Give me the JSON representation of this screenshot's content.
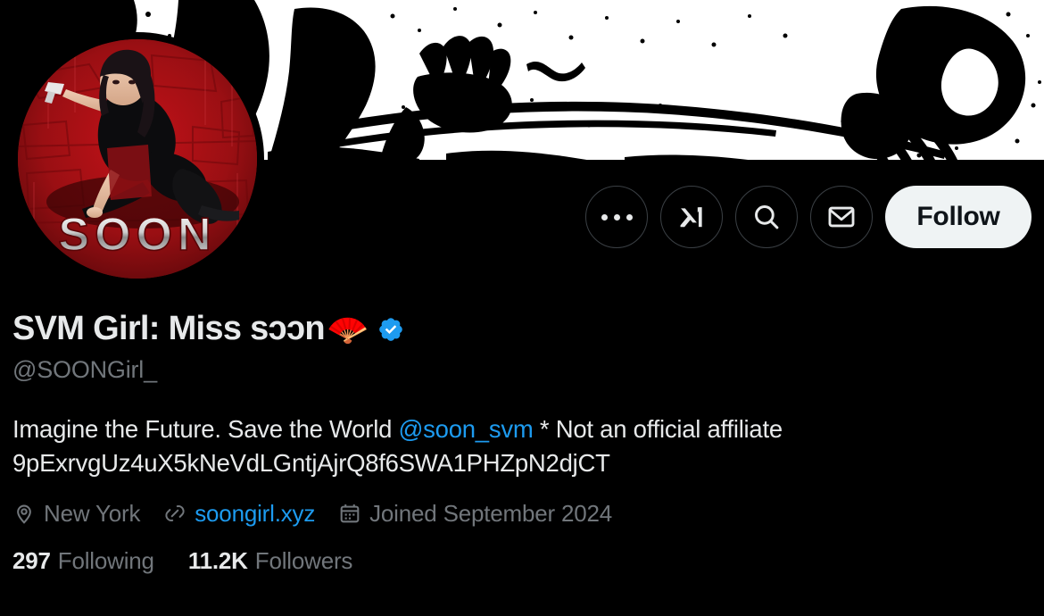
{
  "banner": {
    "alt": "high-contrast black and white dithered manga artwork banner",
    "background_color": "#ffffff",
    "ink_color": "#000000"
  },
  "avatar": {
    "alt": "red toned photo collage of a woman in black outfit holding a gun with SOON logotype",
    "base_color": "#8b0f10",
    "label": "SOON"
  },
  "actions": {
    "more_label": "More",
    "more_icon": "ellipsis-icon",
    "grok_label": "Grok",
    "grok_icon": "xai-grok-icon",
    "search_label": "Search",
    "search_icon": "search-icon",
    "message_label": "Message",
    "message_icon": "envelope-icon",
    "follow_label": "Follow"
  },
  "profile": {
    "display_name": "SVM Girl: Miss sɔɔn",
    "name_emoji": "🪭",
    "verified": true,
    "verified_icon": "verified-badge-icon",
    "verified_color": "#1d9bf0",
    "handle": "@SOONGirl_",
    "bio_line_1_before": "Imagine the Future. Save the World ",
    "bio_mention": "@soon_svm",
    "bio_line_1_after": " * Not an official affiliate",
    "bio_line_2": "9pExrvgUz4uX5kNeVdLGntjAjrQ8f6SWA1PHZpN2djCT",
    "location": "New York",
    "location_icon": "location-pin-icon",
    "website": "soongirl.xyz",
    "website_icon": "link-icon",
    "joined": "Joined September 2024",
    "joined_icon": "calendar-icon",
    "following_count": "297",
    "following_label": "Following",
    "followers_count": "11.2K",
    "followers_label": "Followers"
  },
  "theme": {
    "background": "#000000",
    "primary_text": "#e7e9ea",
    "secondary_text": "#71767b",
    "accent": "#1d9bf0",
    "button_bg": "#eff3f4",
    "border": "#3b4045"
  }
}
